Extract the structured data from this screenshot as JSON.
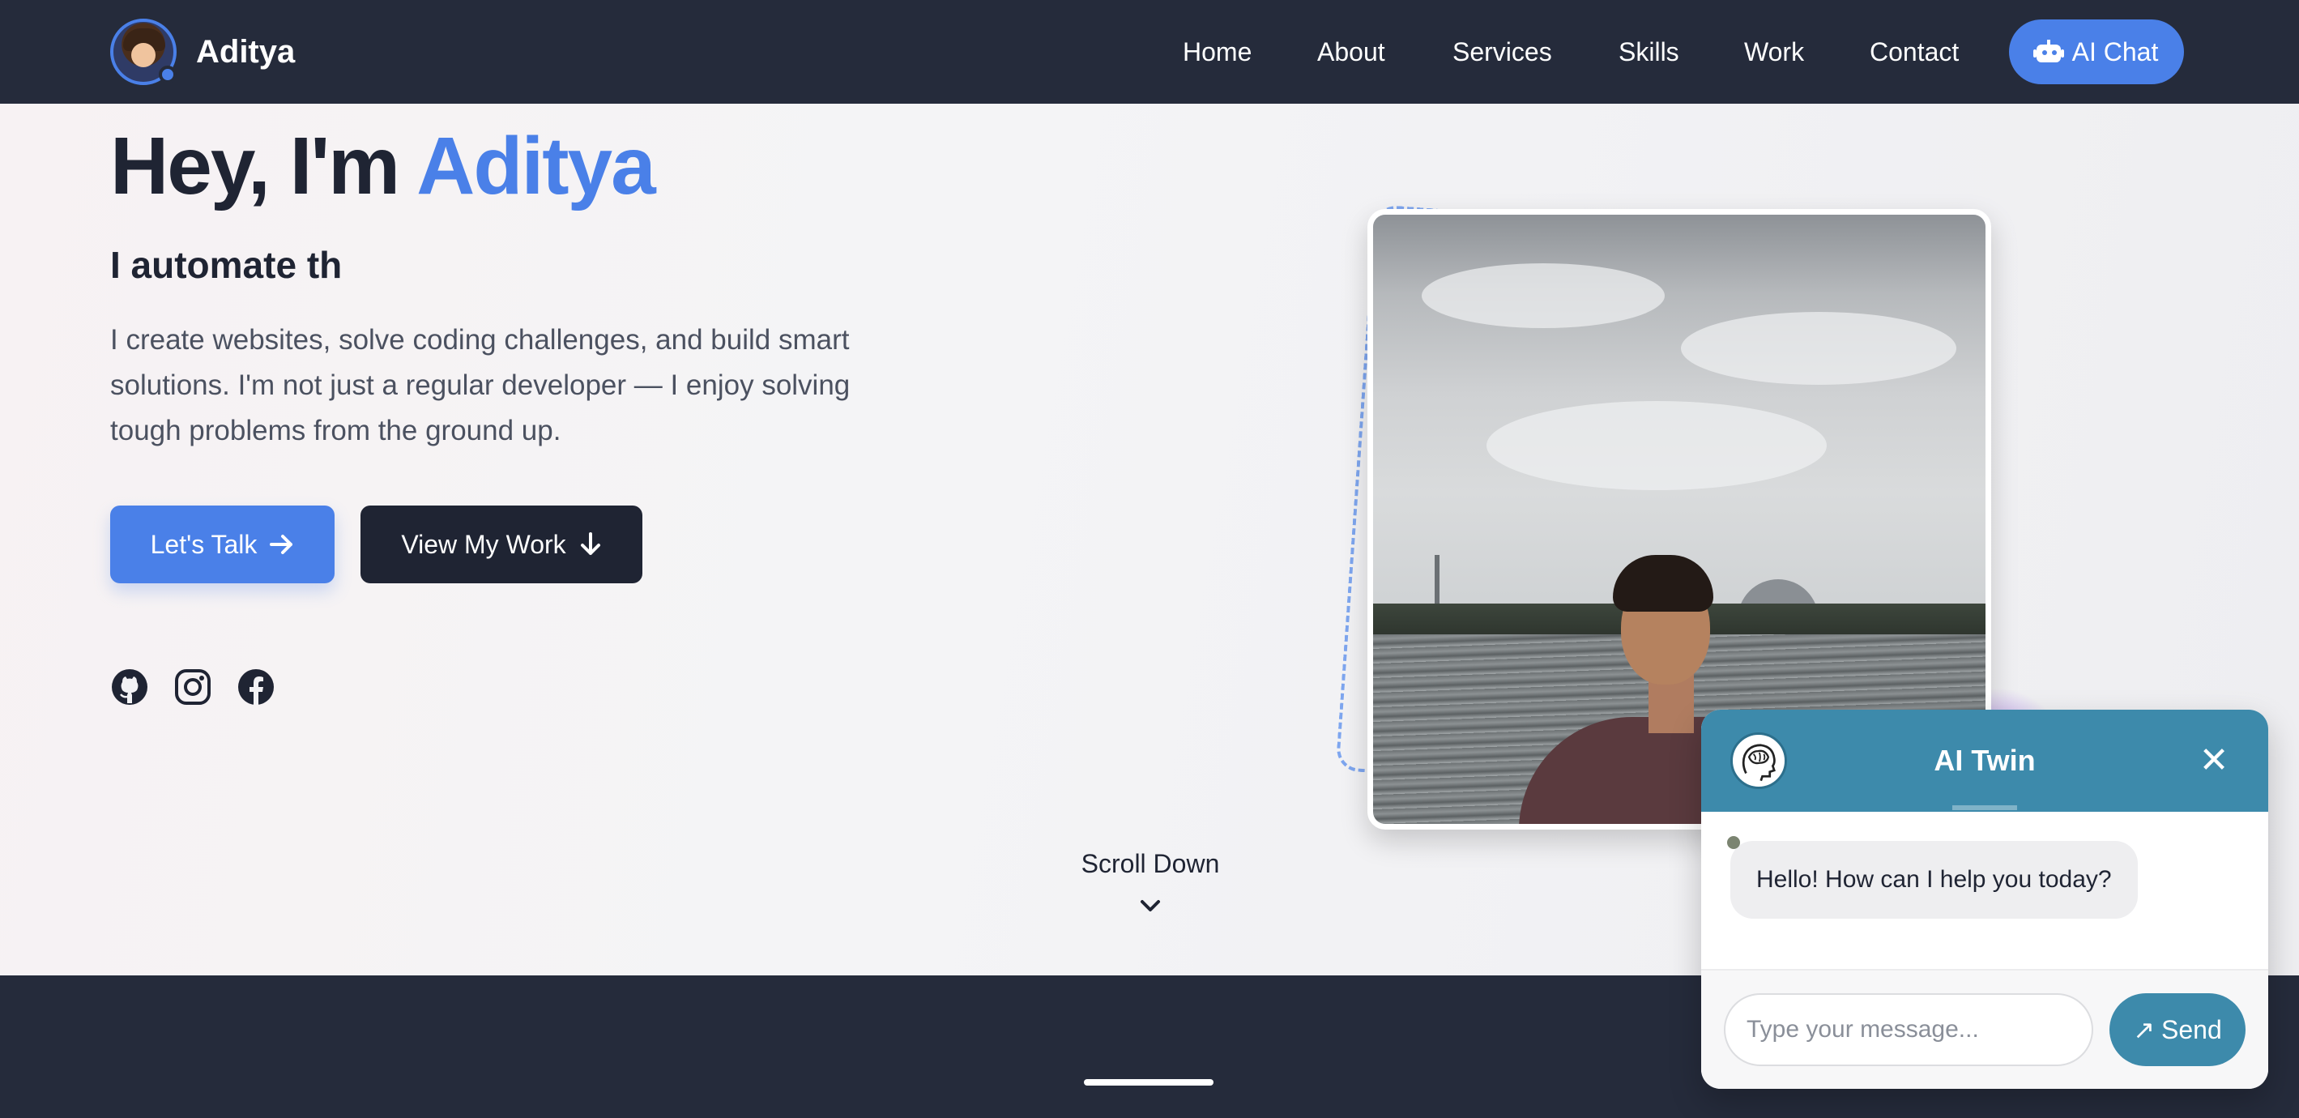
{
  "navbar": {
    "brand_name": "Aditya",
    "links": [
      "Home",
      "About",
      "Services",
      "Skills",
      "Work",
      "Contact"
    ],
    "cta_label": "AI Chat",
    "cta_icon": "robot-icon"
  },
  "hero": {
    "greeting": "Hey, I'm ",
    "name": "Aditya",
    "subtitle": "I automate th",
    "description": "I create websites, solve coding challenges, and build smart solutions. I'm not just a regular developer — I enjoy solving tough problems from the ground up.",
    "primary_button": "Let's Talk",
    "secondary_button": "View My Work",
    "socials": [
      "github-icon",
      "instagram-icon",
      "facebook-icon"
    ],
    "scroll_label": "Scroll Down"
  },
  "chat": {
    "title": "AI Twin",
    "close_glyph": "✕",
    "message": "Hello! How can I help you today?",
    "input_placeholder": "Type your message...",
    "send_label": "Send",
    "send_glyph": "↗"
  },
  "colors": {
    "accent": "#4a80e8",
    "navbar_bg": "#252b3b",
    "chat_header": "#3d8aab"
  }
}
